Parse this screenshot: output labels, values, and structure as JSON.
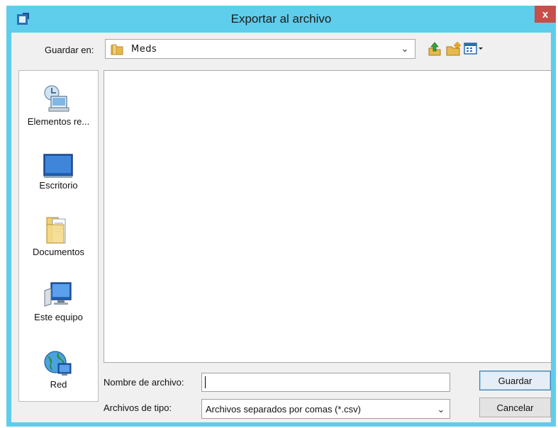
{
  "window": {
    "title": "Exportar al archivo",
    "close_label": "x"
  },
  "save_in": {
    "label": "Guardar en:",
    "value": "Meds"
  },
  "toolbar": {
    "icons": [
      "up-one-level-icon",
      "create-new-folder-icon",
      "view-menu-icon"
    ]
  },
  "places": [
    {
      "label": "Elementos re...",
      "icon": "recent-items-icon"
    },
    {
      "label": "Escritorio",
      "icon": "desktop-icon"
    },
    {
      "label": "Documentos",
      "icon": "documents-icon"
    },
    {
      "label": "Este equipo",
      "icon": "this-pc-icon"
    },
    {
      "label": "Red",
      "icon": "network-icon"
    }
  ],
  "filename": {
    "label": "Nombre de archivo:",
    "value": ""
  },
  "filetype": {
    "label": "Archivos de tipo:",
    "value": "Archivos separados por comas (*.csv)"
  },
  "buttons": {
    "save": "Guardar",
    "cancel": "Cancelar"
  },
  "colors": {
    "frame": "#5fcdec",
    "close": "#c74f4a",
    "dialog_bg": "#f0f0f0"
  }
}
